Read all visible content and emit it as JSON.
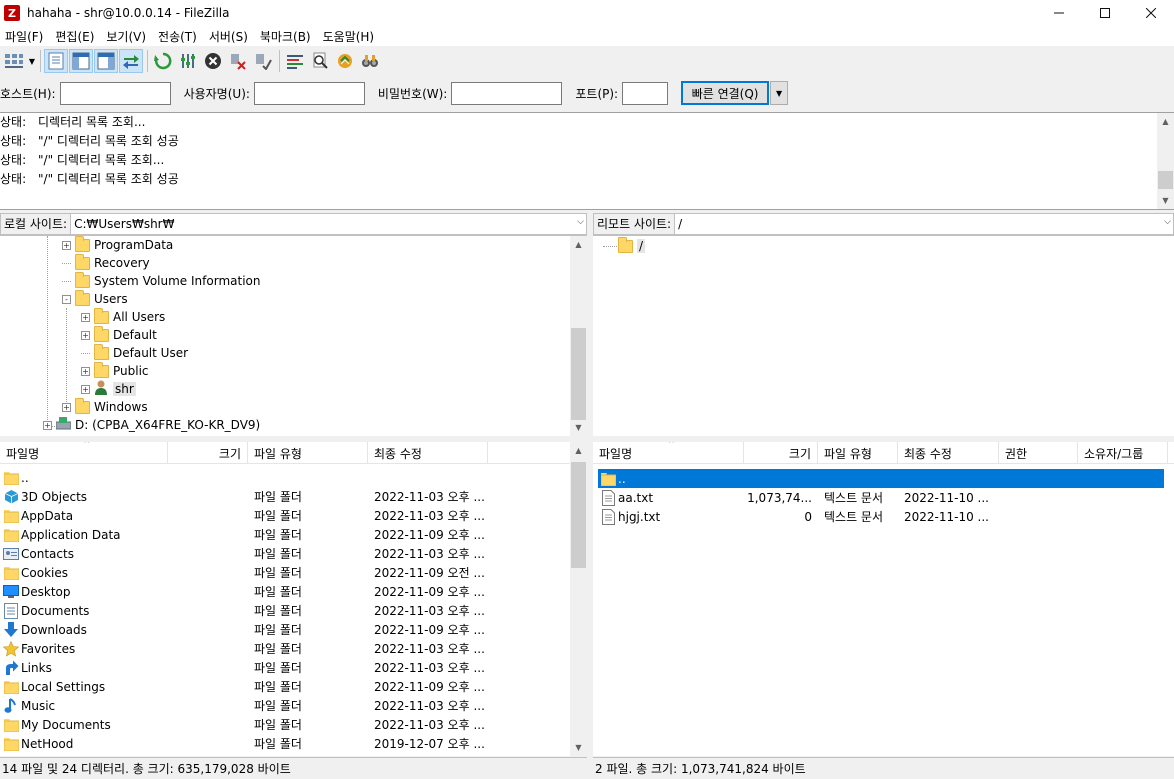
{
  "window": {
    "title": "hahaha - shr@10.0.0.14 - FileZilla",
    "app_icon_letter": "Z"
  },
  "menu": [
    "파일(F)",
    "편집(E)",
    "보기(V)",
    "전송(T)",
    "서버(S)",
    "북마크(B)",
    "도움말(H)"
  ],
  "toolbar": {
    "icons": [
      "site-manager-icon",
      "dropdown-arrow-icon",
      "toggle-log-icon",
      "toggle-local-tree-icon",
      "toggle-remote-tree-icon",
      "toggle-queue-icon",
      "refresh-icon",
      "process-queue-icon",
      "cancel-icon",
      "disconnect-icon",
      "reconnect-icon",
      "filter-icon",
      "search-icon",
      "compare-icon",
      "find-files-icon"
    ]
  },
  "quickconnect": {
    "host_label": "호스트(H):",
    "host_value": "",
    "user_label": "사용자명(U):",
    "user_value": "",
    "pass_label": "비밀번호(W):",
    "pass_value": "",
    "port_label": "포트(P):",
    "port_value": "",
    "connect_button": "빠른 연결(Q)"
  },
  "log": [
    {
      "key": "상태:",
      "msg": "디렉터리 목록 조회..."
    },
    {
      "key": "상태:",
      "msg": "\"/\" 디렉터리 목록 조회 성공"
    },
    {
      "key": "상태:",
      "msg": "\"/\" 디렉터리 목록 조회..."
    },
    {
      "key": "상태:",
      "msg": "\"/\" 디렉터리 목록 조회 성공"
    }
  ],
  "local": {
    "site_label": "로컬 사이트:",
    "path": "C:₩Users₩shr₩",
    "tree": [
      {
        "label": "ProgramData",
        "expander": "+"
      },
      {
        "label": "Recovery",
        "expander": ""
      },
      {
        "label": "System Volume Information",
        "expander": ""
      },
      {
        "label": "Users",
        "expander": "-"
      },
      {
        "label": "All Users",
        "expander": "+"
      },
      {
        "label": "Default",
        "expander": "+"
      },
      {
        "label": "Default User",
        "expander": ""
      },
      {
        "label": "Public",
        "expander": "+"
      },
      {
        "label": "shr",
        "expander": "+"
      },
      {
        "label": "Windows",
        "expander": "+"
      },
      {
        "label": "D: (CPBA_X64FRE_KO-KR_DV9)",
        "expander": "+"
      }
    ],
    "columns": [
      "파일명",
      "크기",
      "파일 유형",
      "최종 수정"
    ],
    "files": [
      {
        "name": "..",
        "type": "",
        "modified": "",
        "icon": "folder"
      },
      {
        "name": "3D Objects",
        "type": "파일 폴더",
        "modified": "2022-11-03 오후 ...",
        "icon": "3d"
      },
      {
        "name": "AppData",
        "type": "파일 폴더",
        "modified": "2022-11-03 오후 ...",
        "icon": "folder"
      },
      {
        "name": "Application Data",
        "type": "파일 폴더",
        "modified": "2022-11-09 오후 ...",
        "icon": "folder"
      },
      {
        "name": "Contacts",
        "type": "파일 폴더",
        "modified": "2022-11-03 오후 ...",
        "icon": "contacts"
      },
      {
        "name": "Cookies",
        "type": "파일 폴더",
        "modified": "2022-11-09 오전 ...",
        "icon": "folder"
      },
      {
        "name": "Desktop",
        "type": "파일 폴더",
        "modified": "2022-11-09 오후 ...",
        "icon": "desktop"
      },
      {
        "name": "Documents",
        "type": "파일 폴더",
        "modified": "2022-11-03 오후 ...",
        "icon": "documents"
      },
      {
        "name": "Downloads",
        "type": "파일 폴더",
        "modified": "2022-11-09 오후 ...",
        "icon": "downloads"
      },
      {
        "name": "Favorites",
        "type": "파일 폴더",
        "modified": "2022-11-03 오후 ...",
        "icon": "favorites"
      },
      {
        "name": "Links",
        "type": "파일 폴더",
        "modified": "2022-11-03 오후 ...",
        "icon": "links"
      },
      {
        "name": "Local Settings",
        "type": "파일 폴더",
        "modified": "2022-11-09 오후 ...",
        "icon": "folder"
      },
      {
        "name": "Music",
        "type": "파일 폴더",
        "modified": "2022-11-03 오후 ...",
        "icon": "music"
      },
      {
        "name": "My Documents",
        "type": "파일 폴더",
        "modified": "2022-11-03 오후 ...",
        "icon": "folder"
      },
      {
        "name": "NetHood",
        "type": "파일 폴더",
        "modified": "2019-12-07 오후 ...",
        "icon": "folder"
      }
    ],
    "status": "14 파일 및 24 디렉터리. 총 크기: 635,179,028 바이트"
  },
  "remote": {
    "site_label": "리모트 사이트:",
    "path": "/",
    "tree_root": "/",
    "columns": [
      "파일명",
      "크기",
      "파일 유형",
      "최종 수정",
      "권한",
      "소유자/그룹"
    ],
    "files": [
      {
        "name": "..",
        "size": "",
        "type": "",
        "modified": "",
        "icon": "folder"
      },
      {
        "name": "aa.txt",
        "size": "1,073,74...",
        "type": "텍스트 문서",
        "modified": "2022-11-10 ...",
        "icon": "txt"
      },
      {
        "name": "hjgj.txt",
        "size": "0",
        "type": "텍스트 문서",
        "modified": "2022-11-10 ...",
        "icon": "txt"
      }
    ],
    "status": "2 파일. 총 크기: 1,073,741,824 바이트"
  }
}
